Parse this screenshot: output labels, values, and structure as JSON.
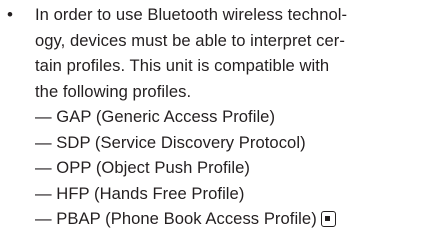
{
  "document": {
    "bullet": "•",
    "paragraph_lines": [
      "In order to use Bluetooth wireless technol-",
      "ogy, devices must be able to interpret cer-",
      "tain profiles. This unit is compatible with",
      "the following profiles."
    ],
    "profiles": [
      "— GAP (Generic Access Profile)",
      "— SDP (Service Discovery Protocol)",
      "— OPP (Object Push Profile)",
      "— HFP (Hands Free Profile)",
      "— PBAP (Phone Book Access Profile)"
    ],
    "end_mark_icon": "section-end-icon"
  }
}
